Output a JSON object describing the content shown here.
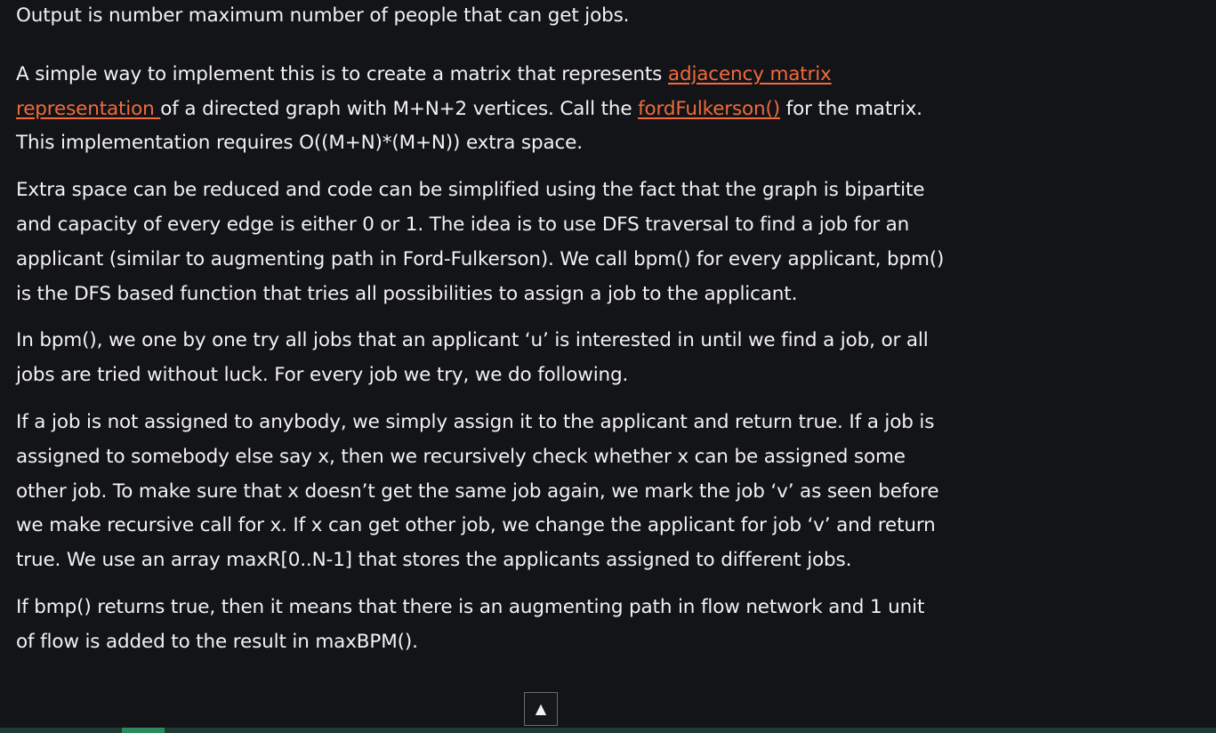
{
  "article": {
    "p1": "Output is number maximum number of people that can get jobs.",
    "p2": {
      "text_before": "A simple way to implement this is to create a matrix that represents ",
      "link_adjacency": "adjacency matrix representation ",
      "text_mid": "of a directed graph with M+N+2 vertices. Call the ",
      "link_ford": "fordFulkerson()",
      "text_after": " for the matrix. This implementation requires O((M+N)*(M+N)) extra space."
    },
    "p3": "Extra space can be reduced and code can be simplified using the fact that the graph is bipartite and capacity of every edge is either 0 or 1. The idea is to use DFS traversal to find a job for an applicant (similar to augmenting path in Ford-Fulkerson). We call bpm() for every applicant, bpm() is the DFS based function that tries all possibilities to assign a job to the applicant.",
    "p4": "In bpm(), we one by one try all jobs that an applicant ‘u’ is interested in until we find a job, or all jobs are tried without luck. For every job we try, we do following.",
    "p5": "If a job is not assigned to anybody, we simply assign it to the applicant and return true. If a job is assigned to somebody else say x, then we recursively check whether x can be assigned some other job. To make sure that x doesn’t get the same job again, we mark the job ‘v’ as seen before we make recursive call for x. If x can get other job, we change the applicant for job ‘v’ and return true. We use an array maxR[0..N-1] that stores the applicants assigned to different jobs.",
    "p6": "If bmp() returns true, then it means that there is an augmenting path in flow network and 1 unit of flow is added to the result in maxBPM()."
  },
  "scroll_top": {
    "glyph": "▲",
    "icon": "arrow-up-icon"
  },
  "colors": {
    "background": "#131417",
    "text": "#f2f2f2",
    "link": "#f26a3d",
    "bottom_bar": "#1f3b33",
    "bottom_bar_active": "#2e8a5e"
  }
}
